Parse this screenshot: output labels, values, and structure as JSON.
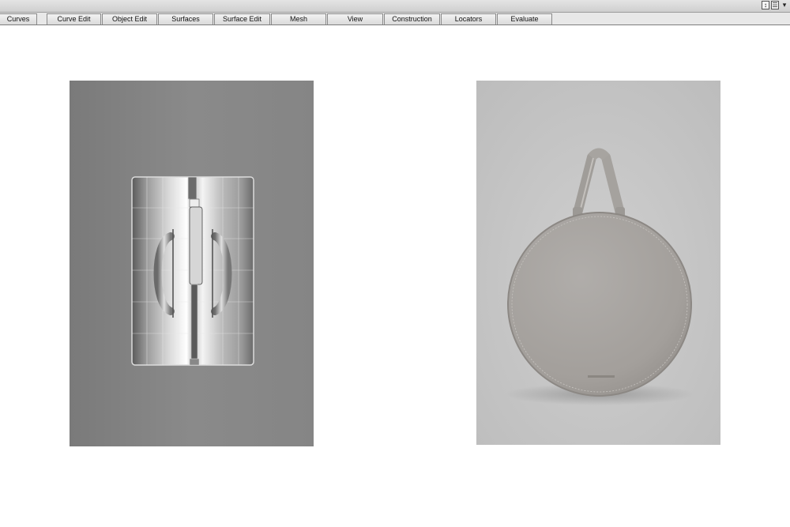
{
  "window": {
    "controls": [
      {
        "name": "resize-icon",
        "glyph": "↕"
      },
      {
        "name": "list-icon",
        "glyph": "☰"
      },
      {
        "name": "chevron-down-icon",
        "glyph": "▾"
      }
    ]
  },
  "shelf_tabs": [
    {
      "label": "Curves"
    },
    {
      "label": "Curve Edit"
    },
    {
      "label": "Object Edit"
    },
    {
      "label": "Surfaces"
    },
    {
      "label": "Surface Edit"
    },
    {
      "label": "Mesh"
    },
    {
      "label": "View"
    },
    {
      "label": "Construction"
    },
    {
      "label": "Locators"
    },
    {
      "label": "Evaluate"
    }
  ],
  "viewport": {
    "left_panel": {
      "content": "uv-layout-bag-texture",
      "background": "#878787"
    },
    "right_panel": {
      "content": "round-leather-bag-photo",
      "background": "#c3c3c3",
      "bag_color": "#a7a4a0"
    }
  }
}
